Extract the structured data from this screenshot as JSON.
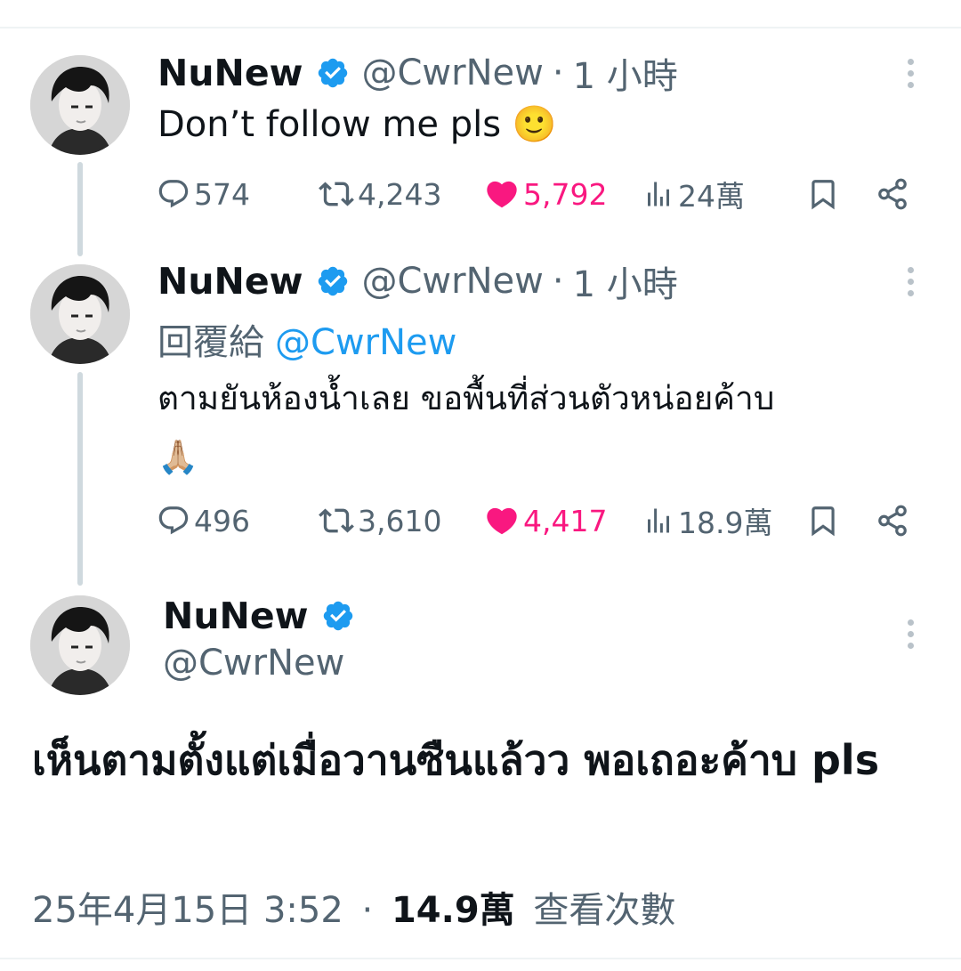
{
  "tweets": [
    {
      "name": "NuNew",
      "handle": "@CwrNew",
      "separator": "·",
      "time": "1 小時",
      "text": "Don’t follow me pls 🙂",
      "replies": "574",
      "retweets": "4,243",
      "likes": "5,792",
      "views": "24萬"
    },
    {
      "name": "NuNew",
      "handle": "@CwrNew",
      "separator": "·",
      "time": "1 小時",
      "reply_prefix": "回覆給",
      "reply_to": "@CwrNew",
      "text_line1": "ตามยันห้องน้ำเลย ขอพื้นที่ส่วนตัวหน่อยค้าบ",
      "text_line2": "🙏🏼",
      "replies": "496",
      "retweets": "3,610",
      "likes": "4,417",
      "views": "18.9萬"
    }
  ],
  "main_tweet": {
    "name": "NuNew",
    "handle": "@CwrNew",
    "text": "เห็นตามตั้งแต่เมื่อวานซืนแล้วว พอเถอะค้าบ pls",
    "timestamp": "25年4月15日 3:52",
    "separator": "·",
    "views_count": "14.9萬",
    "views_label": "查看次數"
  },
  "colors": {
    "verified": "#1d9bf0",
    "like": "#f91880",
    "muted_text": "#536471",
    "mention": "#1d9bf0",
    "thread_line": "#cfd9de"
  },
  "icons": [
    "verified-badge-icon",
    "more-options-icon",
    "reply-icon",
    "retweet-icon",
    "heart-icon",
    "views-icon",
    "bookmark-icon",
    "share-icon"
  ]
}
